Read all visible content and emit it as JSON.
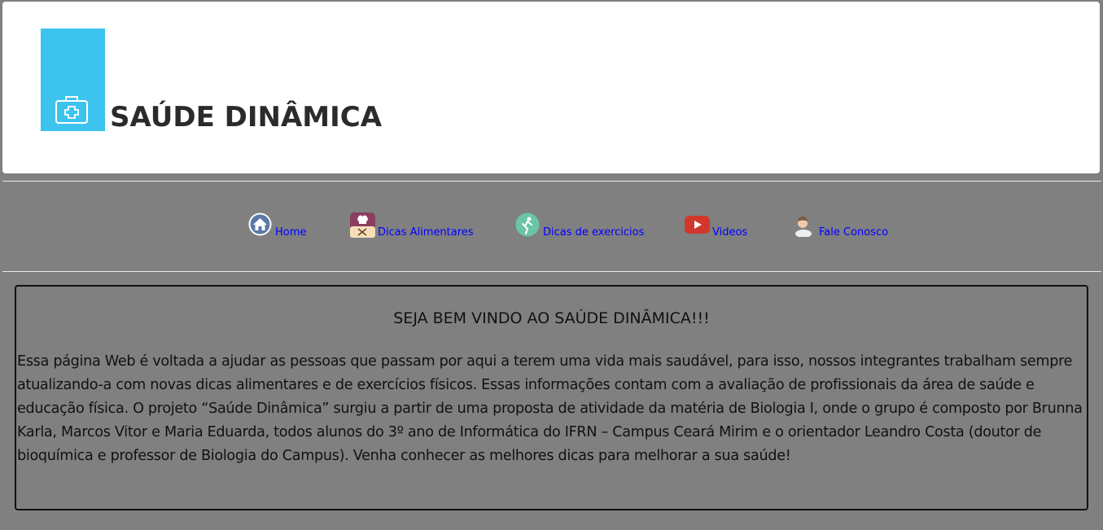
{
  "brand": {
    "name": "SAÚDE DINÂMICA",
    "accent": "#3cc4ef"
  },
  "nav": {
    "items": [
      {
        "label": "Home",
        "icon": "home-icon"
      },
      {
        "label": "Dicas Alimentares",
        "icon": "chef-icon"
      },
      {
        "label": "Dicas de exercicios",
        "icon": "exercise-icon"
      },
      {
        "label": "Videos",
        "icon": "youtube-icon"
      },
      {
        "label": "Fale Conosco",
        "icon": "person-icon"
      }
    ]
  },
  "main": {
    "heading": "SEJA BEM VINDO AO SAÚDE DINÂMICA!!!",
    "paragraph": "Essa página Web é voltada a ajudar as pessoas que passam por aqui a terem uma vida mais saudável, para isso, nossos integrantes trabalham sempre atualizando-a com novas dicas alimentares e de exercícios físicos. Essas informações contam com a avaliação de profissionais da área de saúde e educação física. O projeto “Saúde Dinâmica” surgiu a partir de uma proposta de atividade da matéria de Biologia I, onde o grupo é composto por Brunna Karla, Marcos Vitor e Maria Eduarda, todos alunos do 3º ano de Informática do IFRN – Campus Ceará Mirim e o orientador Leandro Costa (doutor de bioquímica e professor de Biologia do Campus). Venha conhecer as melhores dicas para melhorar a sua saúde!"
  },
  "colors": {
    "background": "#808080",
    "link": "#0000ff"
  }
}
